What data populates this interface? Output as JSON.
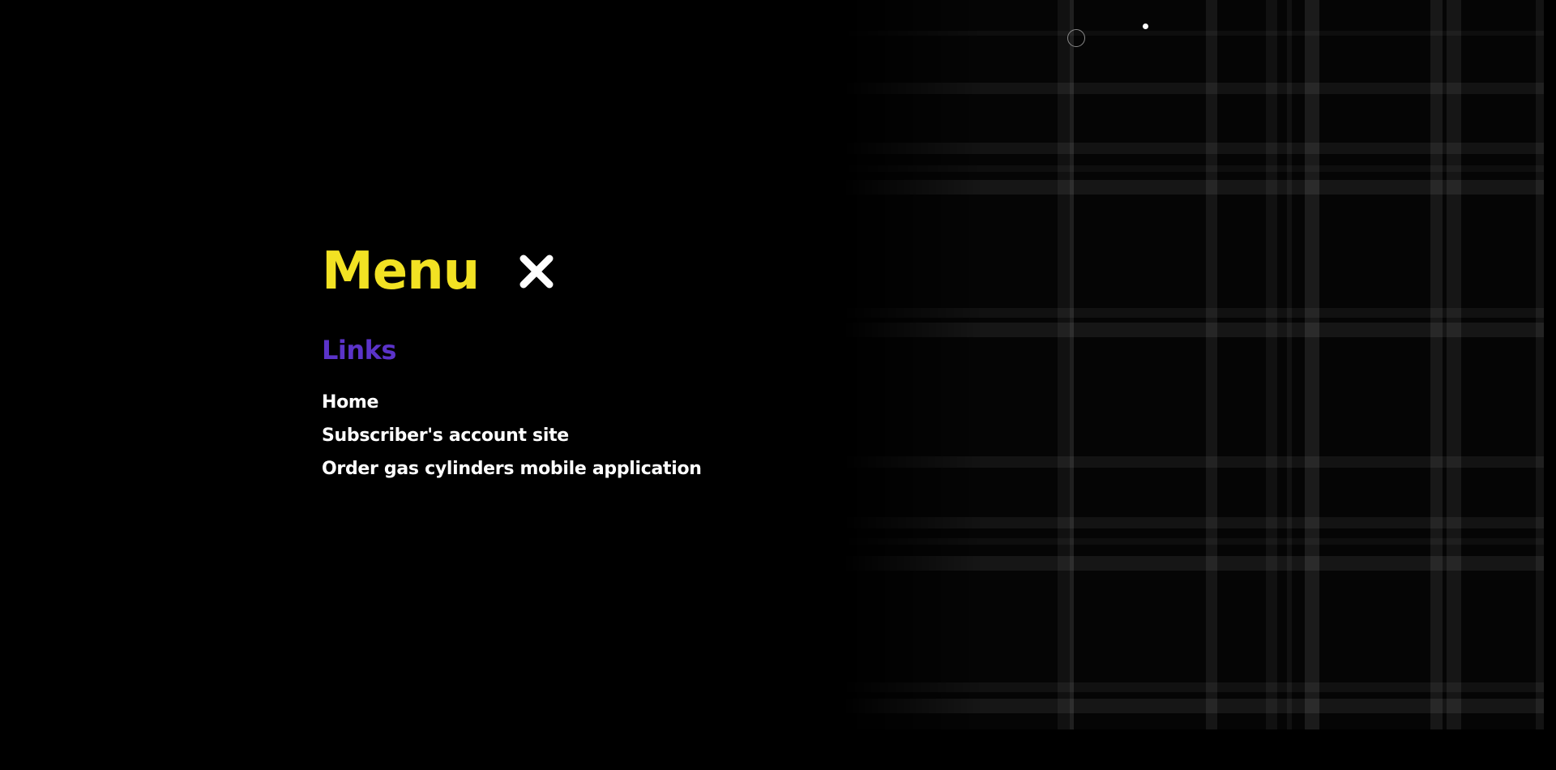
{
  "colors": {
    "background": "#000000",
    "menu_title": "#f2e223",
    "section_title": "#5b33c9",
    "link": "#ffffff",
    "close_icon": "#ffffff"
  },
  "menu": {
    "title": "Menu",
    "close_icon": "close-icon"
  },
  "links_section": {
    "title": "Links",
    "items": [
      {
        "label": "Home"
      },
      {
        "label": "Subscriber's account site"
      },
      {
        "label": "Order gas cylinders mobile application"
      }
    ]
  }
}
